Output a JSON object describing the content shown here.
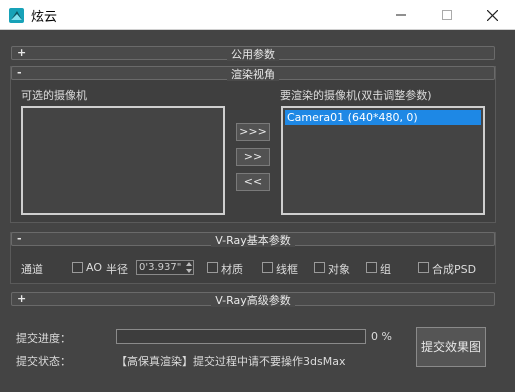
{
  "window": {
    "title": "炫云",
    "icon": "xuanyun-logo-icon",
    "controls": [
      "minimize-icon",
      "maximize-icon",
      "close-icon"
    ]
  },
  "rollouts": {
    "common": {
      "sign": "+",
      "title": "公用参数"
    },
    "render_view": {
      "sign": "-",
      "title": "渲染视角"
    },
    "vray_basic": {
      "sign": "-",
      "title": "V-Ray基本参数"
    },
    "vray_advanced": {
      "sign": "+",
      "title": "V-Ray高级参数"
    }
  },
  "cameras": {
    "available_label": "可选的摄像机",
    "selected_label": "要渲染的摄像机(双击调整参数)",
    "available_items": [],
    "selected_items": [
      "Camera01 (640*480, 0)"
    ],
    "buttons": {
      "add_all": ">>>",
      "add": ">>",
      "remove": "<<"
    }
  },
  "vray_basic": {
    "channel_label": "通道",
    "ao_label": "AO",
    "radius_label": "半径",
    "radius_value": "0'3.937\"",
    "material_label": "材质",
    "wireframe_label": "线框",
    "object_label": "对象",
    "group_label": "组",
    "composite_psd_label": "合成PSD"
  },
  "submit": {
    "progress_label": "提交进度：",
    "progress_percent": 0,
    "progress_text": "0 %",
    "status_label": "提交状态：",
    "status_text": "【高保真渲染】提交过程中请不要操作3dsMax",
    "button_label": "提交效果图"
  },
  "colors": {
    "background": "#444444",
    "selection": "#1e88e5"
  }
}
